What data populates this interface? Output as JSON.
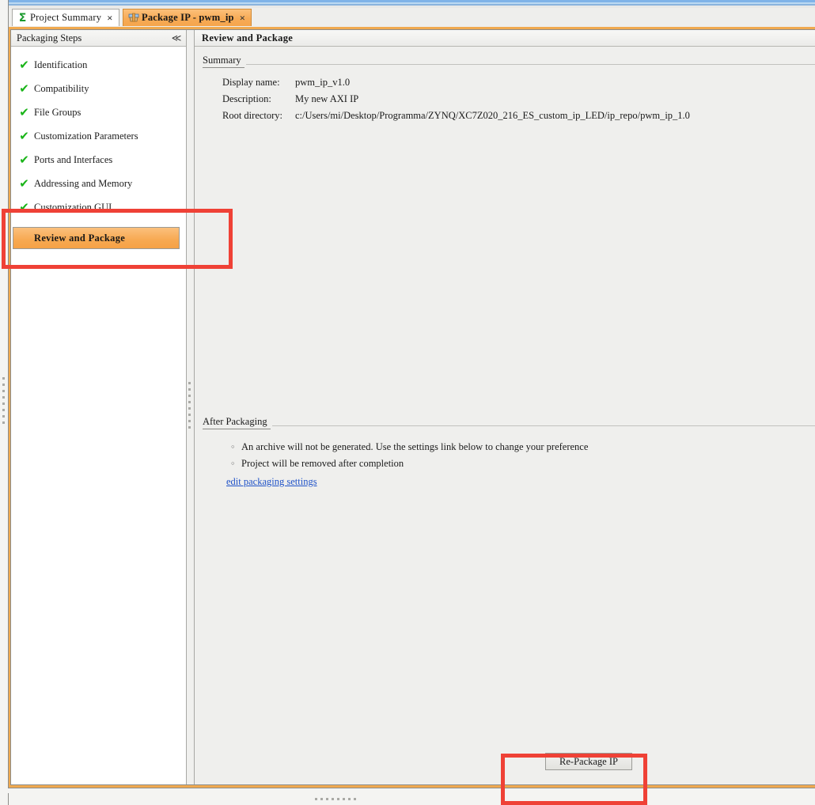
{
  "window": {
    "tabs": [
      {
        "label": "Project Summary",
        "icon": "sigma-icon",
        "close": "×",
        "active": false
      },
      {
        "label": "Package IP - pwm_ip",
        "icon": "package-ip-icon",
        "close": "×",
        "active": true
      }
    ]
  },
  "sidebar": {
    "title": "Packaging Steps",
    "collapse_icon": "≪",
    "items": [
      {
        "label": "Identification",
        "status": "complete",
        "check": "✔"
      },
      {
        "label": "Compatibility",
        "status": "complete",
        "check": "✔"
      },
      {
        "label": "File Groups",
        "status": "complete",
        "check": "✔"
      },
      {
        "label": "Customization Parameters",
        "status": "complete",
        "check": "✔"
      },
      {
        "label": "Ports and Interfaces",
        "status": "complete",
        "check": "✔"
      },
      {
        "label": "Addressing and Memory",
        "status": "complete",
        "check": "✔"
      },
      {
        "label": "Customization GUI",
        "status": "complete",
        "check": "✔"
      }
    ],
    "selected_item": {
      "label": "Review and Package",
      "status": "current"
    }
  },
  "content": {
    "title": "Review and Package",
    "summary": {
      "heading": "Summary",
      "rows": [
        {
          "key": "Display name:",
          "value": "pwm_ip_v1.0"
        },
        {
          "key": "Description:",
          "value": "My new AXI IP"
        },
        {
          "key": "Root directory:",
          "value": "c:/Users/mi/Desktop/Programma/ZYNQ/XC7Z020_216_ES_custom_ip_LED/ip_repo/pwm_ip_1.0"
        }
      ]
    },
    "after_packaging": {
      "heading": "After Packaging",
      "bullets": [
        {
          "marker": "◦",
          "text": "An archive will not be generated. Use the settings link below to change your preference"
        },
        {
          "marker": "◦",
          "text": "Project will be removed after completion"
        }
      ],
      "link": "edit packaging settings"
    },
    "repackage_button": "Re-Package IP"
  },
  "colors": {
    "accent_orange": "#f5a54c",
    "highlight_orange": "#f7a951",
    "annotation_red": "#ef4136",
    "check_green": "#19b418",
    "link_blue": "#1f52c8"
  }
}
